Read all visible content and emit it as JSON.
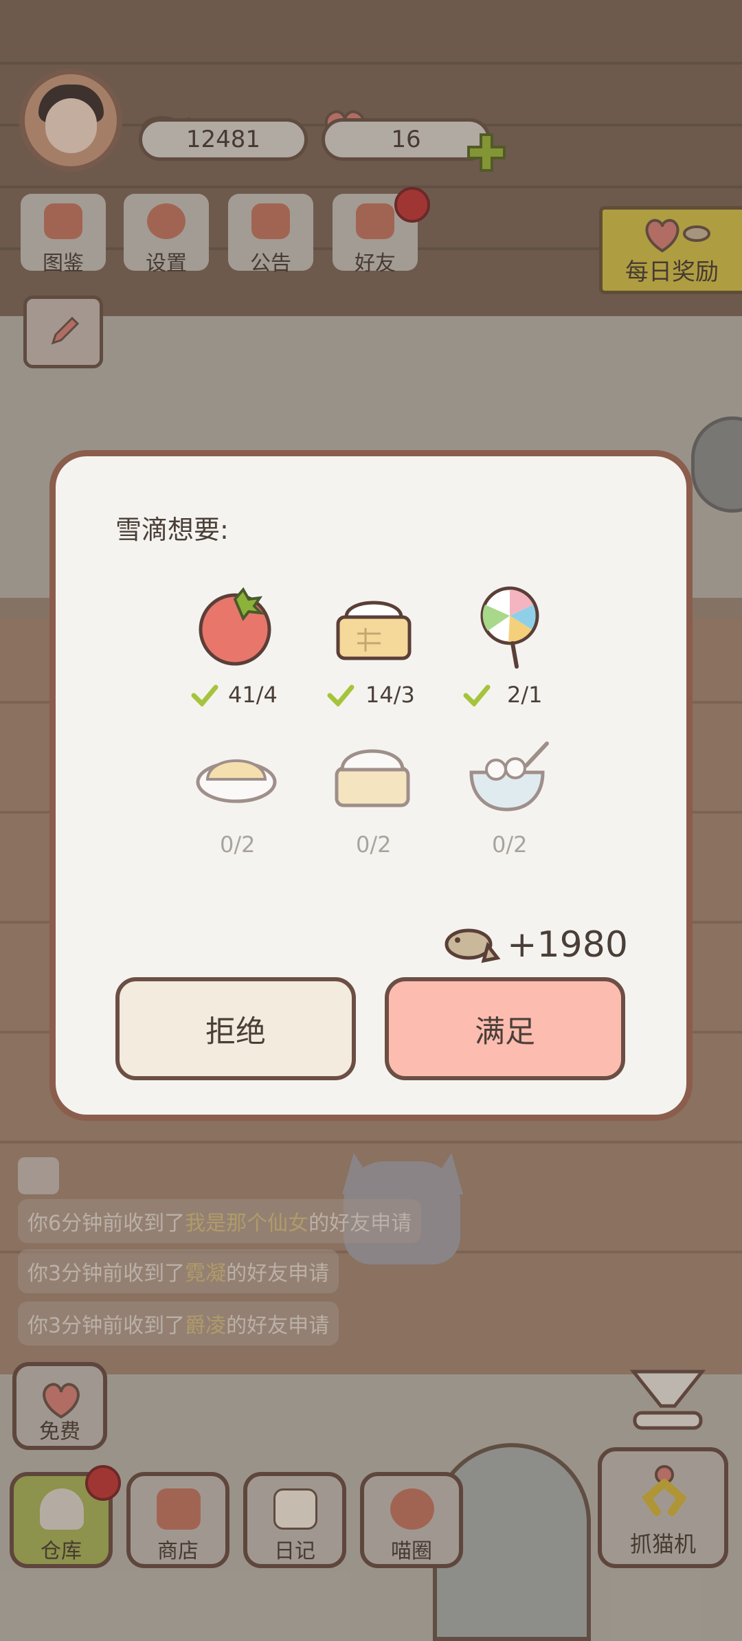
{
  "top_bar": {
    "fish_count": "12481",
    "heart_count": "16"
  },
  "menu": [
    {
      "label": "图鉴",
      "icon": "cat-book-icon"
    },
    {
      "label": "设置",
      "icon": "gear-icon"
    },
    {
      "label": "公告",
      "icon": "gift-icon"
    },
    {
      "label": "好友",
      "icon": "friends-icon"
    }
  ],
  "daily_reward": {
    "label": "每日奖励"
  },
  "dialog": {
    "title": "雪滴想要:",
    "items": [
      {
        "name": "tomato",
        "progress": "41/4",
        "done": true
      },
      {
        "name": "steamed-bun",
        "progress": "14/3",
        "done": true
      },
      {
        "name": "lollipop",
        "progress": "2/1",
        "done": true
      },
      {
        "name": "fried-rice",
        "progress": "0/2",
        "done": false
      },
      {
        "name": "dumpling",
        "progress": "0/2",
        "done": false
      },
      {
        "name": "tangyuan-bowl",
        "progress": "0/2",
        "done": false
      }
    ],
    "reward": "+1980",
    "reject_label": "拒绝",
    "accept_label": "满足"
  },
  "feed": [
    {
      "prefix": "你6分钟前收到了",
      "name": "我是那个仙女",
      "suffix": "的好友申请"
    },
    {
      "prefix": "你3分钟前收到了",
      "name": "霓凝",
      "suffix": "的好友申请"
    },
    {
      "prefix": "你3分钟前收到了",
      "name": "爵凌",
      "suffix": "的好友申请"
    }
  ],
  "bottom_bar": {
    "free_label": "免费",
    "items": [
      {
        "label": "仓库",
        "icon": "storage-icon"
      },
      {
        "label": "商店",
        "icon": "shop-icon"
      },
      {
        "label": "日记",
        "icon": "diary-icon"
      },
      {
        "label": "喵圈",
        "icon": "cat-planet-icon"
      }
    ],
    "claw_label": "抓猫机"
  },
  "colors": {
    "accept": "#fdbcb0",
    "reject": "#f3ebdd",
    "dialog_border": "#8b5d4d",
    "badge": "#c23a3a",
    "check": "#a5c43c"
  }
}
